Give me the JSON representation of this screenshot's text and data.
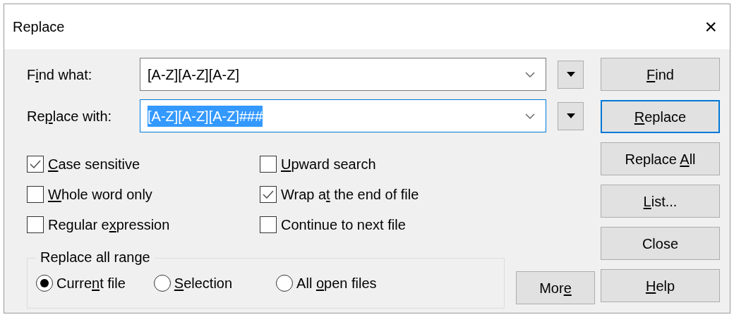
{
  "window": {
    "title": "Replace",
    "close": "×"
  },
  "fields": [
    {
      "label": {
        "pre": "F",
        "key": "i",
        "post": "nd what:"
      },
      "value": "[A-Z][A-Z][A-Z]",
      "focused": false,
      "selected_text": false
    },
    {
      "label": {
        "pre": "Re",
        "key": "p",
        "post": "lace with:"
      },
      "value": "[A-Z][A-Z][A-Z]###",
      "focused": true,
      "selected_text": true
    }
  ],
  "options": [
    {
      "label": {
        "key": "C",
        "post": "ase sensitive"
      },
      "checked": true
    },
    {
      "label": {
        "key": "U",
        "post": "pward search"
      },
      "checked": false
    },
    {
      "label": {
        "key": "W",
        "post": "hole word only"
      },
      "checked": false
    },
    {
      "label": {
        "pre": "Wrap a",
        "key": "t",
        "post": " the end of file"
      },
      "checked": true
    },
    {
      "label": {
        "pre": "Regular e",
        "key": "x",
        "post": "pression"
      },
      "checked": false
    },
    {
      "label": {
        "pre": "Continue to next file"
      },
      "checked": false
    }
  ],
  "range": {
    "title": "Replace all range",
    "choices": [
      {
        "label": {
          "pre": "Curre",
          "key": "n",
          "post": "t file"
        },
        "selected": true
      },
      {
        "label": {
          "key": "S",
          "post": "election"
        },
        "selected": false
      },
      {
        "label": {
          "pre": "All ",
          "key": "o",
          "post": "pen files"
        },
        "selected": false
      }
    ]
  },
  "buttons": [
    {
      "label": {
        "key": "F",
        "post": "ind"
      },
      "default": false
    },
    {
      "label": {
        "key": "R",
        "post": "eplace"
      },
      "default": true
    },
    {
      "label": {
        "pre": "Replace ",
        "key": "A",
        "post": "ll"
      },
      "default": false
    },
    {
      "label": {
        "key": "L",
        "post": "ist..."
      },
      "default": false
    },
    {
      "label": {
        "pre": "Close"
      },
      "default": false
    },
    {
      "label": {
        "key": "H",
        "post": "elp"
      },
      "default": false
    }
  ],
  "more_button": {
    "label": {
      "pre": "Mor",
      "key": "e"
    }
  }
}
